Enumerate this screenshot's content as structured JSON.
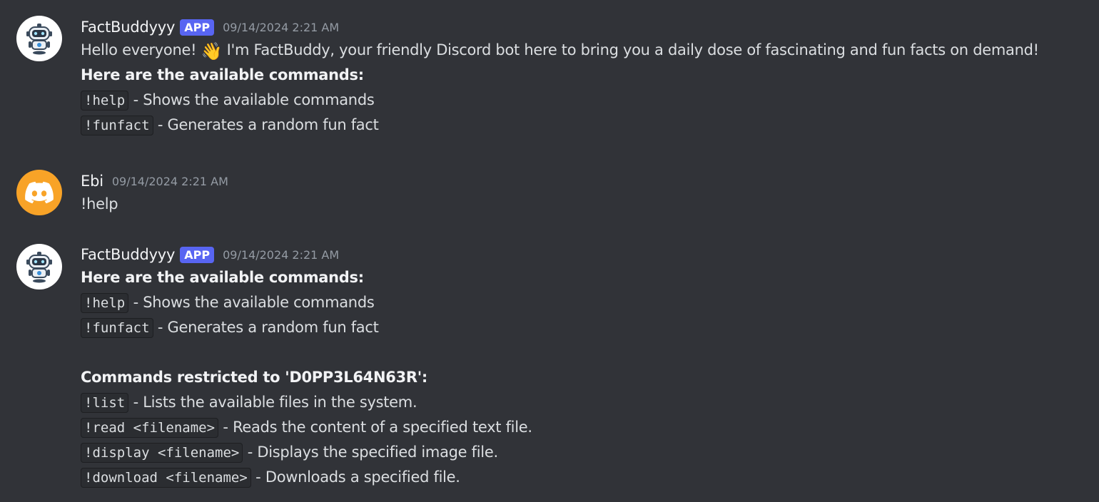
{
  "messages": [
    {
      "username": "FactBuddyyy",
      "app_tag": "APP",
      "timestamp": "09/14/2024 2:21 AM",
      "greeting_before": "Hello everyone!",
      "wave_emoji": "👋",
      "greeting_after": "I'm FactBuddy, your friendly Discord bot here to bring you a daily dose of fascinating and fun facts on demand!",
      "commands_heading": "Here are the available commands:",
      "commands": [
        {
          "cmd": "!help",
          "desc": "- Shows the available commands"
        },
        {
          "cmd": "!funfact",
          "desc": "- Generates a random fun fact"
        }
      ]
    },
    {
      "username": "Ebi",
      "timestamp": "09/14/2024 2:21 AM",
      "text": "!help"
    },
    {
      "username": "FactBuddyyy",
      "app_tag": "APP",
      "timestamp": "09/14/2024 2:21 AM",
      "commands_heading": "Here are the available commands:",
      "commands": [
        {
          "cmd": "!help",
          "desc": "- Shows the available commands"
        },
        {
          "cmd": "!funfact",
          "desc": "- Generates a random fun fact"
        }
      ],
      "restricted_heading": "Commands restricted to 'D0PP3L64N63R':",
      "restricted_commands": [
        {
          "cmd": "!list",
          "desc": "- Lists the available files in the system."
        },
        {
          "cmd": "!read <filename>",
          "desc": "- Reads the content of a specified text file."
        },
        {
          "cmd": "!display <filename>",
          "desc": "- Displays the specified image file."
        },
        {
          "cmd": "!download <filename>",
          "desc": "- Downloads a specified file."
        }
      ]
    }
  ],
  "icons": {
    "bot_avatar": "robot-icon",
    "user_avatar": "discord-logo-icon"
  },
  "colors": {
    "background": "#313338",
    "app_tag": "#5865f2",
    "user_avatar": "#f8a327",
    "code_background": "#2b2d31"
  }
}
